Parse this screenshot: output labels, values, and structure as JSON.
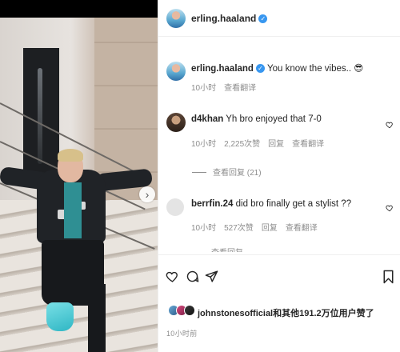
{
  "header": {
    "username": "erling.haaland"
  },
  "caption": {
    "username": "erling.haaland",
    "text": "You know the vibes..",
    "emoji": "😎",
    "time": "10小时",
    "translate": "查看翻译"
  },
  "comments": [
    {
      "username": "d4khan",
      "text": "Yh bro enjoyed that 7-0",
      "time": "10小时",
      "likes": "2,225次赞",
      "reply": "回复",
      "translate": "查看翻译",
      "view_replies": "查看回复 (21)"
    },
    {
      "username": "berrfin.24",
      "text": "did bro finally get a stylist ??",
      "time": "10小时",
      "likes": "527次赞",
      "reply": "回复",
      "translate": "查看翻译",
      "partial_text": "查看回复"
    }
  ],
  "likes_line": {
    "text": "johnstonesofficial和其他191.2万位用户赞了"
  },
  "post_time": "10小时前",
  "icons": {
    "verified": "verified-badge-icon",
    "heart": "heart-icon",
    "comment": "comment-icon",
    "share": "share-icon",
    "save": "bookmark-icon",
    "next": "chevron-right-icon"
  },
  "colors": {
    "verified_blue": "#3897f0",
    "muted_text": "#8e8e8e",
    "divider": "#efefef"
  }
}
